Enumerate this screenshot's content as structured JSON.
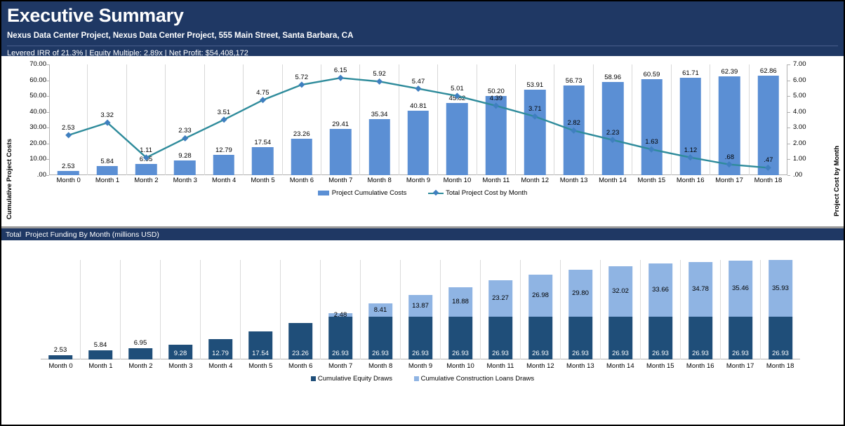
{
  "header": {
    "title": "Executive Summary",
    "subtitle": "Nexus Data Center Project, Nexus Data Center Project, 555 Main Street, Santa Barbara, CA",
    "metrics": "Levered IRR of 21.3% | Equity Multiple: 2.89x | Net Profit: $54,408,172",
    "bg_color": "#1F3864"
  },
  "section2": {
    "title": "Total  Project Funding By Month (millions USD)"
  },
  "legend1": {
    "bars_label": "Project Cumulative Costs",
    "line_label": "Total Project Cost by Month"
  },
  "legend2": {
    "equity_label": "Cumulative Equity Draws",
    "loans_label": "Cumulative Construction Loans Draws"
  },
  "colors": {
    "bar_blue": "#5B8FD4",
    "line_teal": "#2E8B9B",
    "marker_blue": "#3f7fbf",
    "equity_navy": "#1F4E79",
    "loans_lightblue": "#8FB4E3",
    "header_navy": "#1F3864"
  },
  "chart_data": [
    {
      "type": "bar",
      "title": "",
      "xlabel": "",
      "ylabel": "Cumulative Project Costs",
      "y2label": "Project Cost by Month",
      "ylim": [
        0,
        70
      ],
      "y2lim": [
        0,
        7
      ],
      "yticks": [
        "70.00",
        "60.00",
        "50.00",
        "40.00",
        "30.00",
        "20.00",
        "10.00",
        ".00"
      ],
      "y2ticks": [
        "7.00",
        "6.00",
        "5.00",
        "4.00",
        "3.00",
        "2.00",
        "1.00",
        ".00"
      ],
      "grid": false,
      "legend_position": "bottom",
      "categories": [
        "Month 0",
        "Month 1",
        "Month 2",
        "Month 3",
        "Month 4",
        "Month 5",
        "Month 6",
        "Month 7",
        "Month 8",
        "Month 9",
        "Month 10",
        "Month 11",
        "Month 12",
        "Month 13",
        "Month 14",
        "Month 15",
        "Month 16",
        "Month 17",
        "Month 18"
      ],
      "series": [
        {
          "name": "Project Cumulative Costs",
          "axis": "left",
          "values": [
            2.53,
            5.84,
            6.95,
            9.28,
            12.79,
            17.54,
            23.26,
            29.41,
            35.34,
            40.81,
            45.82,
            50.2,
            53.91,
            56.73,
            58.96,
            60.59,
            61.71,
            62.39,
            62.86
          ],
          "labels": [
            "2.53",
            "5.84",
            "6.95",
            "9.28",
            "12.79",
            "17.54",
            "23.26",
            "29.41",
            "35.34",
            "40.81",
            "45.82",
            "50.20",
            "53.91",
            "56.73",
            "58.96",
            "60.59",
            "61.71",
            "62.39",
            "62.86"
          ]
        },
        {
          "name": "Total Project Cost by Month",
          "axis": "right",
          "values": [
            2.53,
            3.32,
            1.11,
            2.33,
            3.51,
            4.75,
            5.72,
            6.15,
            5.92,
            5.47,
            5.01,
            4.39,
            3.71,
            2.82,
            2.23,
            1.63,
            1.12,
            0.68,
            0.47
          ],
          "labels": [
            "2.53",
            "3.32",
            "1.11",
            "2.33",
            "3.51",
            "4.75",
            "5.72",
            "6.15",
            "5.92",
            "5.47",
            "5.01",
            "4.39",
            "3.71",
            "2.82",
            "2.23",
            "1.63",
            "1.12",
            ".68",
            ".47"
          ]
        }
      ]
    },
    {
      "type": "bar",
      "stacked": true,
      "title": "Total  Project Funding By Month (millions USD)",
      "xlabel": "",
      "ylabel": "",
      "ylim": [
        0,
        63
      ],
      "grid": false,
      "legend_position": "bottom",
      "categories": [
        "Month 0",
        "Month 1",
        "Month 2",
        "Month 3",
        "Month 4",
        "Month 5",
        "Month 6",
        "Month 7",
        "Month 8",
        "Month 9",
        "Month 10",
        "Month 11",
        "Month 12",
        "Month 13",
        "Month 14",
        "Month 15",
        "Month 16",
        "Month 17",
        "Month 18"
      ],
      "series": [
        {
          "name": "Cumulative Equity Draws",
          "values": [
            2.53,
            5.84,
            6.95,
            9.28,
            12.79,
            17.54,
            23.26,
            26.93,
            26.93,
            26.93,
            26.93,
            26.93,
            26.93,
            26.93,
            26.93,
            26.93,
            26.93,
            26.93,
            26.93
          ],
          "labels": [
            "2.53",
            "5.84",
            "6.95",
            "9.28",
            "12.79",
            "17.54",
            "23.26",
            "26.93",
            "26.93",
            "26.93",
            "26.93",
            "26.93",
            "26.93",
            "26.93",
            "26.93",
            "26.93",
            "26.93",
            "26.93",
            "26.93"
          ]
        },
        {
          "name": "Cumulative Construction Loans Draws",
          "values": [
            0,
            0,
            0,
            0,
            0,
            0,
            0,
            2.48,
            8.41,
            13.87,
            18.88,
            23.27,
            26.98,
            29.8,
            32.02,
            33.66,
            34.78,
            35.46,
            35.93
          ],
          "labels": [
            "",
            "",
            "",
            "",
            "",
            "",
            "",
            "2.48",
            "8.41",
            "13.87",
            "18.88",
            "23.27",
            "26.98",
            "29.80",
            "32.02",
            "33.66",
            "34.78",
            "35.46",
            "35.93"
          ]
        }
      ]
    }
  ]
}
